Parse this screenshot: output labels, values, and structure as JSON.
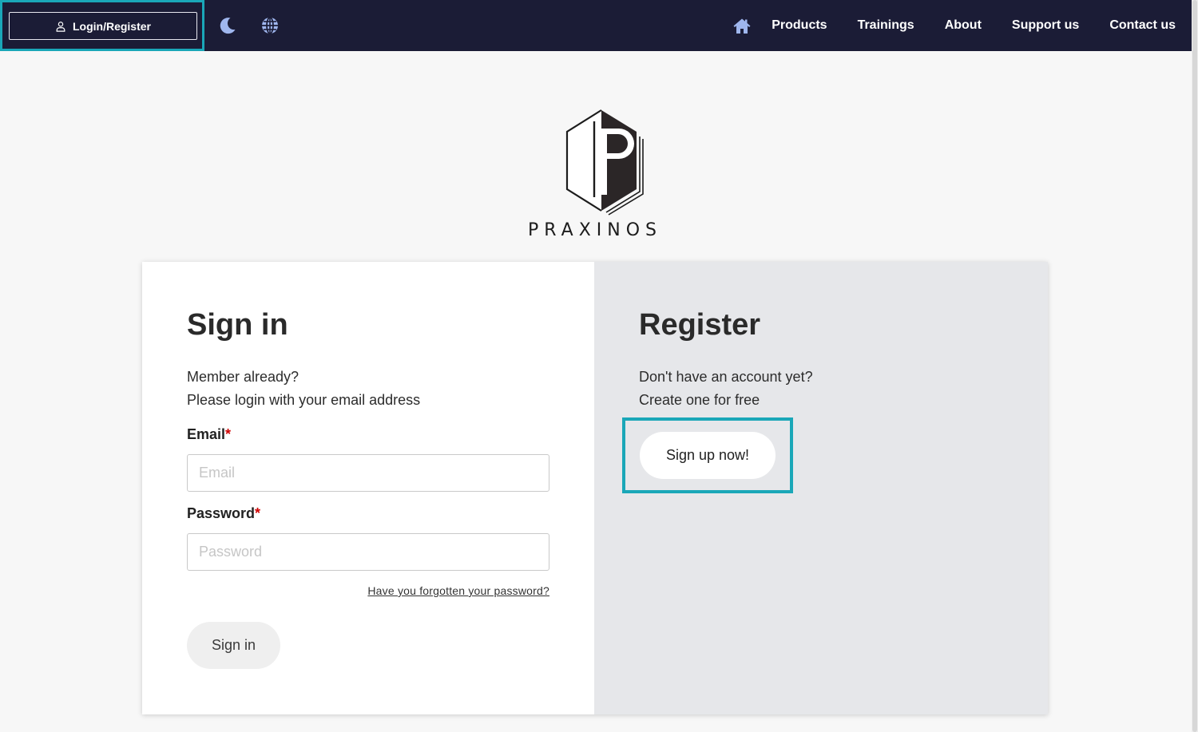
{
  "nav": {
    "login_label": "Login/Register",
    "links": [
      "Products",
      "Trainings",
      "About",
      "Support us",
      "Contact us"
    ],
    "icons": [
      "user-icon",
      "moon-icon",
      "globe-icon",
      "home-icon"
    ]
  },
  "logo": {
    "wordmark": "PRAXINOS"
  },
  "signin": {
    "title": "Sign in",
    "line1": "Member already?",
    "line2": "Please login with your email address",
    "email_label": "Email",
    "email_placeholder": "Email",
    "email_value": "",
    "password_label": "Password",
    "password_placeholder": "Password",
    "password_value": "",
    "required_mark": "*",
    "forgot_label": "Have you forgotten your password?",
    "submit_label": "Sign in"
  },
  "register": {
    "title": "Register",
    "line1": "Don't have an account yet?",
    "line2": "Create one for free",
    "signup_label": "Sign up now!"
  },
  "colors": {
    "nav_bg": "#1b1c36",
    "highlight": "#1aa7b8",
    "register_bg": "#e6e7ea",
    "required": "#d00000"
  }
}
